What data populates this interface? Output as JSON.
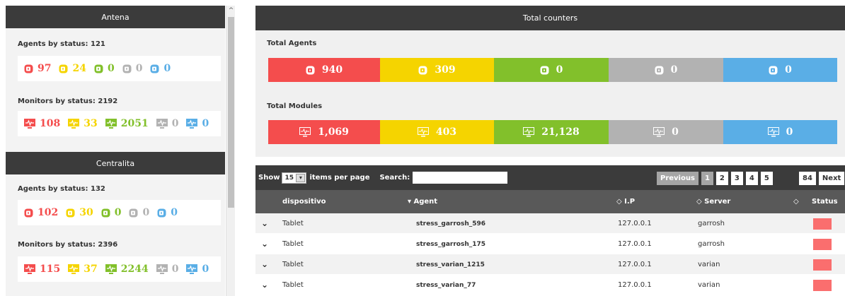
{
  "colors": {
    "red": "#f44d4d",
    "yellow": "#f5d400",
    "green": "#82c02b",
    "gray": "#b2b2b2",
    "blue": "#5aaee6",
    "header_bg": "#3b3b3b",
    "status_red": "#fa6e6e"
  },
  "left": {
    "groups": [
      {
        "name": "Antena",
        "agents_title": "Agents by status: 121",
        "agents": [
          "97",
          "24",
          "0",
          "0",
          "0"
        ],
        "monitors_title": "Monitors by status: 2192",
        "monitors": [
          "108",
          "33",
          "2051",
          "0",
          "0"
        ]
      },
      {
        "name": "Centralita",
        "agents_title": "Agents by status: 132",
        "agents": [
          "102",
          "30",
          "0",
          "0",
          "0"
        ],
        "monitors_title": "Monitors by status: 2396",
        "monitors": [
          "115",
          "37",
          "2244",
          "0",
          "0"
        ]
      }
    ],
    "scroll_up": "^"
  },
  "totals": {
    "header": "Total counters",
    "agents_title": "Total Agents",
    "agents": [
      "940",
      "309",
      "0",
      "0",
      "0"
    ],
    "modules_title": "Total Modules",
    "modules": [
      "1,069",
      "403",
      "21,128",
      "0",
      "0"
    ]
  },
  "table": {
    "show_label": "Show",
    "show_value": "15",
    "perpage_label": "items per page",
    "search_label": "Search:",
    "search_value": "",
    "pager": {
      "previous": "Previous",
      "pages": [
        "1",
        "2",
        "3",
        "4",
        "5"
      ],
      "last": "84",
      "next": "Next"
    },
    "columns": {
      "dispositivo": "dispositivo",
      "agent": "▾ Agent",
      "ip": "◇ I.P",
      "server": "◇ Server",
      "sort_status": "◇",
      "status": "Status"
    },
    "rows": [
      {
        "dispositivo": "Tablet",
        "agent": "stress_garrosh_596",
        "ip": "127.0.0.1",
        "server": "garrosh"
      },
      {
        "dispositivo": "Tablet",
        "agent": "stress_garrosh_175",
        "ip": "127.0.0.1",
        "server": "garrosh"
      },
      {
        "dispositivo": "Tablet",
        "agent": "stress_varian_1215",
        "ip": "127.0.0.1",
        "server": "varian"
      },
      {
        "dispositivo": "Tablet",
        "agent": "stress_varian_77",
        "ip": "127.0.0.1",
        "server": "varian"
      }
    ]
  }
}
